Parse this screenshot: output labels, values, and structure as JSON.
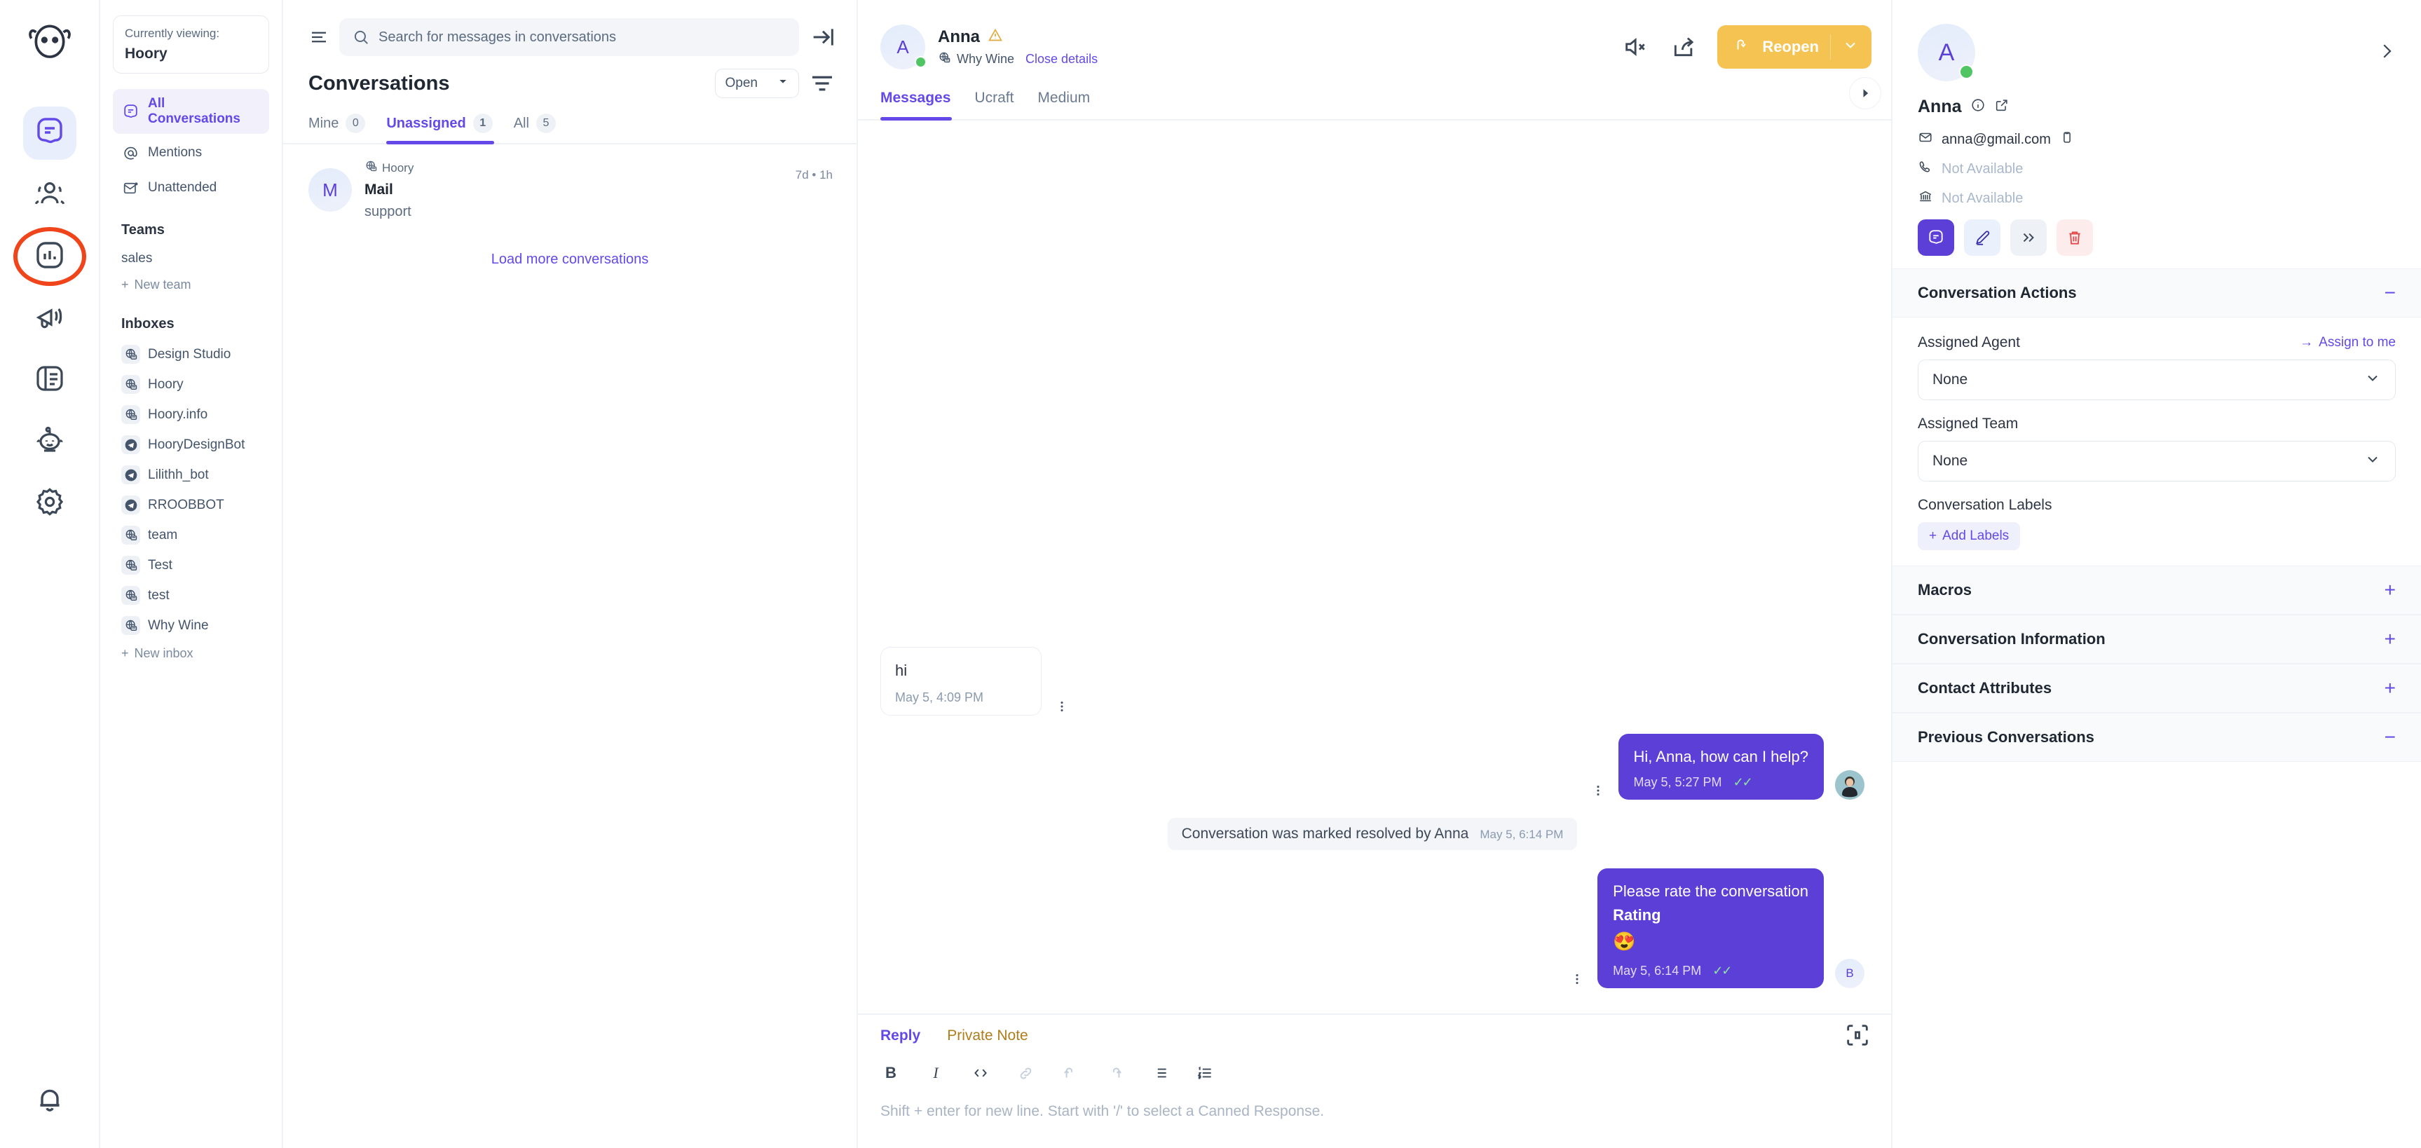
{
  "colors": {
    "accent": "#6449e8",
    "bubble_out": "#5b3fd6",
    "reopen": "#f5c352",
    "online": "#4fc663",
    "highlight_ring": "#f0441b",
    "note": "#b07d1c"
  },
  "rail": {
    "items": [
      {
        "name": "conversations",
        "icon": "chat-icon",
        "active": true
      },
      {
        "name": "contacts",
        "icon": "contacts-icon",
        "active": false
      },
      {
        "name": "reports",
        "icon": "reports-icon",
        "active": false,
        "highlighted": true
      },
      {
        "name": "campaigns",
        "icon": "megaphone-icon",
        "active": false
      },
      {
        "name": "portal",
        "icon": "book-icon",
        "active": false
      },
      {
        "name": "bots",
        "icon": "bot-icon",
        "active": false
      },
      {
        "name": "settings",
        "icon": "gear-icon",
        "active": false
      }
    ],
    "bottom": {
      "name": "notifications",
      "icon": "bell-icon"
    }
  },
  "sidebar": {
    "viewing_label": "Currently viewing:",
    "viewing_name": "Hoory",
    "nav": [
      {
        "label": "All Conversations",
        "icon": "chat-icon",
        "active": true
      },
      {
        "label": "Mentions",
        "icon": "at-icon",
        "active": false
      },
      {
        "label": "Unattended",
        "icon": "envelope-dot-icon",
        "active": false
      }
    ],
    "teams_title": "Teams",
    "teams": [
      {
        "label": "sales"
      }
    ],
    "new_team": "New team",
    "inboxes_title": "Inboxes",
    "inboxes": [
      {
        "label": "Design Studio",
        "channel": "website"
      },
      {
        "label": "Hoory",
        "channel": "website"
      },
      {
        "label": "Hoory.info",
        "channel": "website"
      },
      {
        "label": "HooryDesignBot",
        "channel": "telegram"
      },
      {
        "label": "Lilithh_bot",
        "channel": "telegram"
      },
      {
        "label": "RROOBBOT",
        "channel": "telegram"
      },
      {
        "label": "team",
        "channel": "website"
      },
      {
        "label": "Test",
        "channel": "website"
      },
      {
        "label": "test",
        "channel": "website"
      },
      {
        "label": "Why Wine",
        "channel": "website"
      }
    ],
    "new_inbox": "New inbox"
  },
  "conv_list": {
    "search_placeholder": "Search for messages in conversations",
    "title": "Conversations",
    "status_filter": "Open",
    "tabs": [
      {
        "label": "Mine",
        "count": "0",
        "active": false
      },
      {
        "label": "Unassigned",
        "count": "1",
        "active": true
      },
      {
        "label": "All",
        "count": "5",
        "active": false
      }
    ],
    "rows": [
      {
        "initial": "M",
        "inbox": "Hoory",
        "name": "Mail",
        "snippet": "support",
        "time": "7d • 1h"
      }
    ],
    "load_more": "Load more conversations"
  },
  "chat": {
    "contact_initial": "A",
    "contact_name": "Anna",
    "inbox": "Why Wine",
    "close_details": "Close details",
    "reopen_label": "Reopen",
    "tabs": [
      {
        "label": "Messages",
        "active": true
      },
      {
        "label": "Ucraft",
        "active": false
      },
      {
        "label": "Medium",
        "active": false
      }
    ],
    "messages": [
      {
        "type": "incoming",
        "text": "hi",
        "time": "May 5, 4:09 PM"
      },
      {
        "type": "outgoing",
        "text": "Hi, Anna, how can I help?",
        "time": "May 5, 5:27 PM",
        "status": "✓✓",
        "avatar": "photo"
      },
      {
        "type": "system",
        "text": "Conversation was marked resolved by Anna",
        "time": "May 5, 6:14 PM"
      },
      {
        "type": "outgoing",
        "text": "Please rate the conversation",
        "strong": "Rating",
        "emoji": "😍",
        "time": "May 5, 6:14 PM",
        "status": "✓✓",
        "avatar": "B"
      }
    ],
    "reply": {
      "tab_reply": "Reply",
      "tab_note": "Private Note",
      "placeholder": "Shift + enter for new line. Start with '/' to select a Canned Response.",
      "toolbar": [
        {
          "icon": "bold-icon",
          "glyph": "B",
          "dim": false
        },
        {
          "icon": "italic-icon",
          "glyph": "I",
          "dim": false
        },
        {
          "icon": "code-icon",
          "glyph": "</>",
          "dim": false
        },
        {
          "icon": "link-icon",
          "glyph": "⊜",
          "dim": true
        },
        {
          "icon": "undo-icon",
          "glyph": "↺",
          "dim": true
        },
        {
          "icon": "redo-icon",
          "glyph": "↻",
          "dim": true
        },
        {
          "icon": "bullet-list-icon",
          "glyph": "≔",
          "dim": false
        },
        {
          "icon": "numbered-list-icon",
          "glyph": "≕",
          "dim": false
        }
      ]
    }
  },
  "right_panel": {
    "contact": {
      "initial": "A",
      "name": "Anna",
      "email": "anna@gmail.com",
      "phone": "Not Available",
      "company": "Not Available"
    },
    "sections": [
      {
        "title": "Conversation Actions",
        "expanded": true,
        "toggle": "−",
        "assigned_agent_label": "Assigned Agent",
        "assign_to_me": "Assign to me",
        "assigned_agent_value": "None",
        "assigned_team_label": "Assigned Team",
        "assigned_team_value": "None",
        "labels_title": "Conversation Labels",
        "add_labels": "Add Labels"
      },
      {
        "title": "Macros",
        "expanded": false,
        "toggle": "+"
      },
      {
        "title": "Conversation Information",
        "expanded": false,
        "toggle": "+"
      },
      {
        "title": "Contact Attributes",
        "expanded": false,
        "toggle": "+"
      },
      {
        "title": "Previous Conversations",
        "expanded": true,
        "toggle": "−"
      }
    ]
  }
}
